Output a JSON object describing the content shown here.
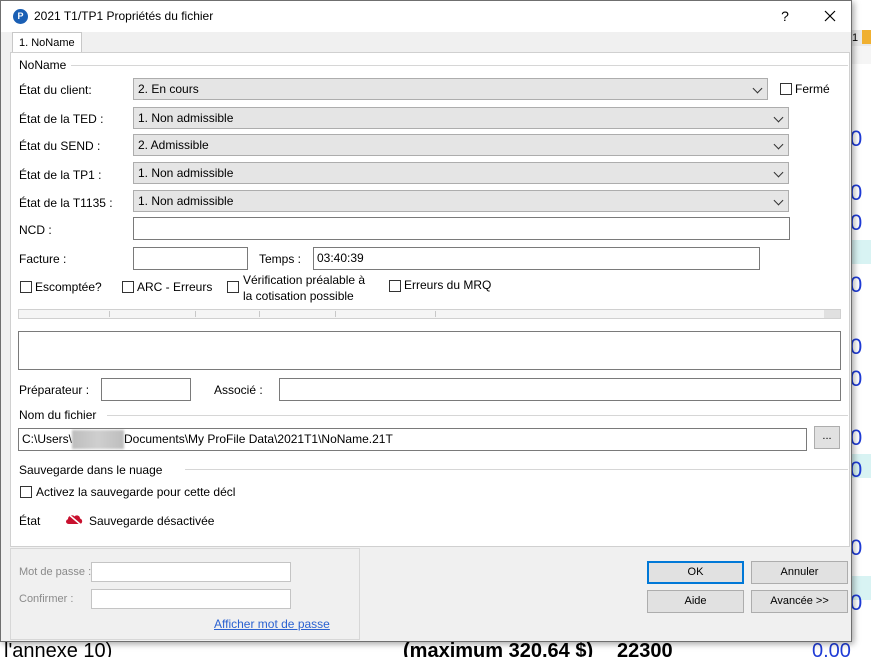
{
  "window": {
    "title": "2021 T1/TP1 Propriétés du fichier",
    "app_icon": "profile-logo-icon",
    "help_label": "?",
    "close_label": "✕"
  },
  "tabs": [
    {
      "label": "1. NoName",
      "active": true
    }
  ],
  "group_main": {
    "title": "NoName"
  },
  "fields": {
    "etat_client": {
      "label": "État du client:",
      "value": "2. En cours"
    },
    "ferme": {
      "label": "Fermé",
      "checked": false
    },
    "ted": {
      "label": "État de la TED :",
      "value": "1. Non admissible"
    },
    "send": {
      "label": "État du SEND :",
      "value": "2. Admissible"
    },
    "tp1": {
      "label": "État de la TP1 :",
      "value": "1. Non admissible"
    },
    "t1135": {
      "label": "État de la T1135 :",
      "value": "1. Non admissible"
    },
    "ncd": {
      "label": "NCD :",
      "value": ""
    },
    "facture": {
      "label": "Facture :",
      "value": ""
    },
    "temps": {
      "label": "Temps :",
      "value": "03:40:39"
    }
  },
  "checkboxes": [
    {
      "label": "Escomptée?",
      "checked": false
    },
    {
      "label": "ARC - Erreurs",
      "checked": false
    },
    {
      "label_line1": "Vérification préalable à",
      "label_line2": "la cotisation possible",
      "checked": false
    },
    {
      "label": "Erreurs du MRQ",
      "checked": false
    }
  ],
  "people": {
    "preparateur": {
      "label": "Préparateur :",
      "value": ""
    },
    "associe": {
      "label": "Associé :",
      "value": ""
    }
  },
  "filename": {
    "group_title": "Nom du fichier",
    "path_prefix": "C:\\Users\\",
    "path_suffix": "Documents\\My ProFile Data\\2021T1\\NoName.21T",
    "browse_label": "..."
  },
  "cloud": {
    "group_title": "Sauvegarde dans le nuage",
    "enable_label": "Activez la sauvegarde pour cette décl",
    "enable_checked": false,
    "state_label": "État",
    "state_value": "Sauvegarde désactivée",
    "state_icon": "cloud-off-icon",
    "state_color": "#c8102e"
  },
  "password": {
    "password_label": "Mot de passe :",
    "confirm_label": "Confirmer :",
    "show_link": "Afficher mot de passe"
  },
  "buttons": {
    "ok": "OK",
    "cancel": "Annuler",
    "help": "Aide",
    "advanced": "Avancée >>"
  },
  "background": {
    "right_numbers": [
      "0",
      "0",
      "0",
      "0",
      "0",
      "0",
      "0",
      "0",
      "0",
      "0",
      "0",
      "0",
      "0",
      "0",
      "0,00"
    ],
    "bottom_text": "l'annexe 10)",
    "bottom_mid": "(maximum 320,64 $)",
    "bottom_value": "22300",
    "top_right_text": "1"
  }
}
